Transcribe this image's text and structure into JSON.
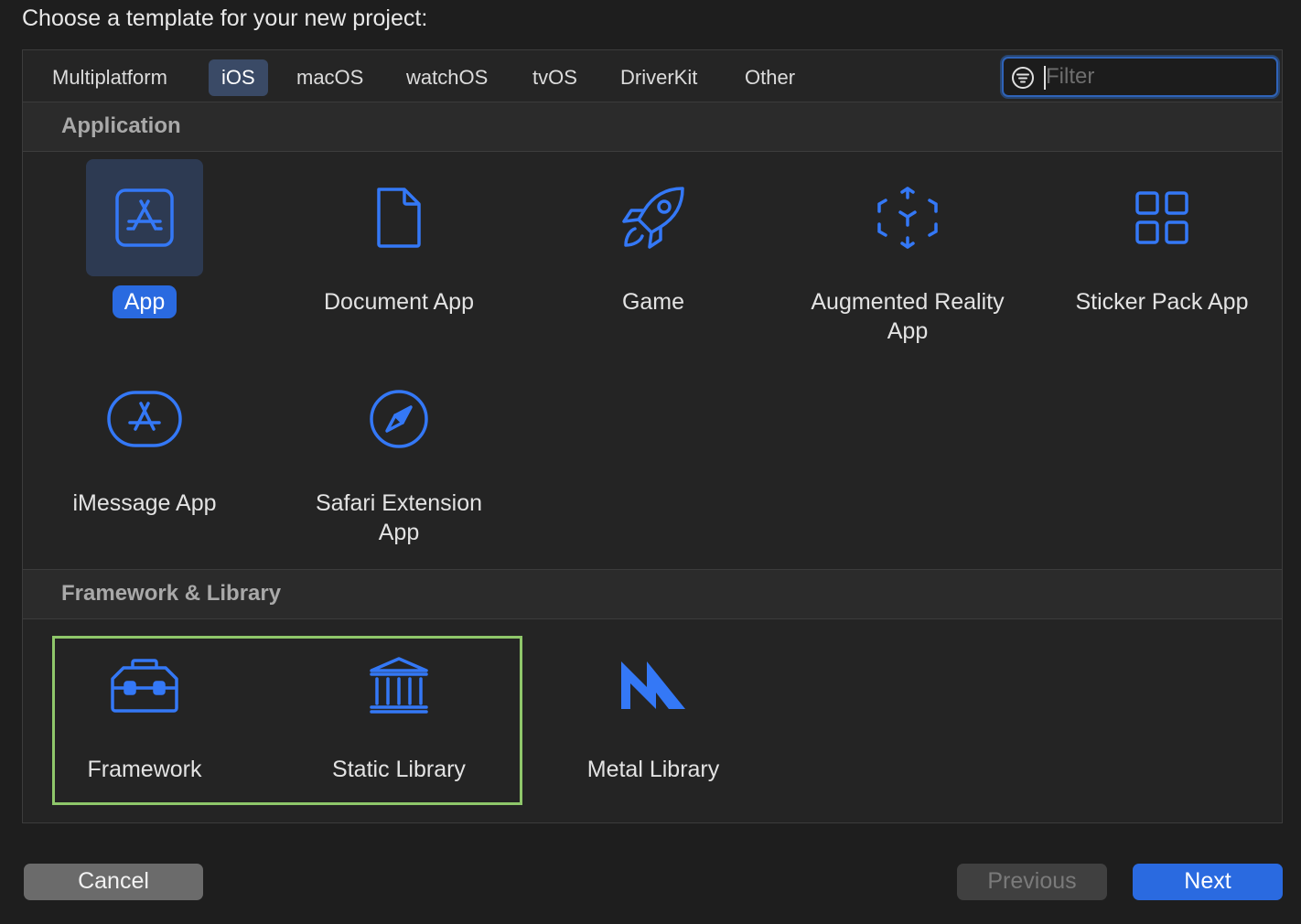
{
  "heading": "Choose a template for your new project:",
  "tabs": [
    {
      "label": "Multiplatform"
    },
    {
      "label": "iOS",
      "selected": true
    },
    {
      "label": "macOS"
    },
    {
      "label": "watchOS"
    },
    {
      "label": "tvOS"
    },
    {
      "label": "DriverKit"
    },
    {
      "label": "Other"
    }
  ],
  "filter": {
    "placeholder": "Filter",
    "value": "",
    "icon": "filter-icon"
  },
  "sections": [
    {
      "title": "Application",
      "items": [
        {
          "label": "App",
          "icon": "app-store-icon",
          "selected": true
        },
        {
          "label": "Document App",
          "icon": "document-icon"
        },
        {
          "label": "Game",
          "icon": "rocket-icon"
        },
        {
          "label": "Augmented Reality App",
          "icon": "ar-cube-icon"
        },
        {
          "label": "Sticker Pack App",
          "icon": "grid-icon"
        },
        {
          "label": "iMessage App",
          "icon": "imessage-app-icon"
        },
        {
          "label": "Safari Extension App",
          "icon": "compass-icon"
        }
      ]
    },
    {
      "title": "Framework & Library",
      "items": [
        {
          "label": "Framework",
          "icon": "toolbox-icon"
        },
        {
          "label": "Static Library",
          "icon": "library-building-icon"
        },
        {
          "label": "Metal Library",
          "icon": "metal-icon"
        }
      ]
    }
  ],
  "buttons": {
    "cancel": "Cancel",
    "previous": "Previous",
    "next": "Next"
  },
  "colors": {
    "accent": "#2a6ae0",
    "icon_blue": "#3478f6",
    "highlight_border": "#8fc76a",
    "background": "#1e1e1e"
  }
}
